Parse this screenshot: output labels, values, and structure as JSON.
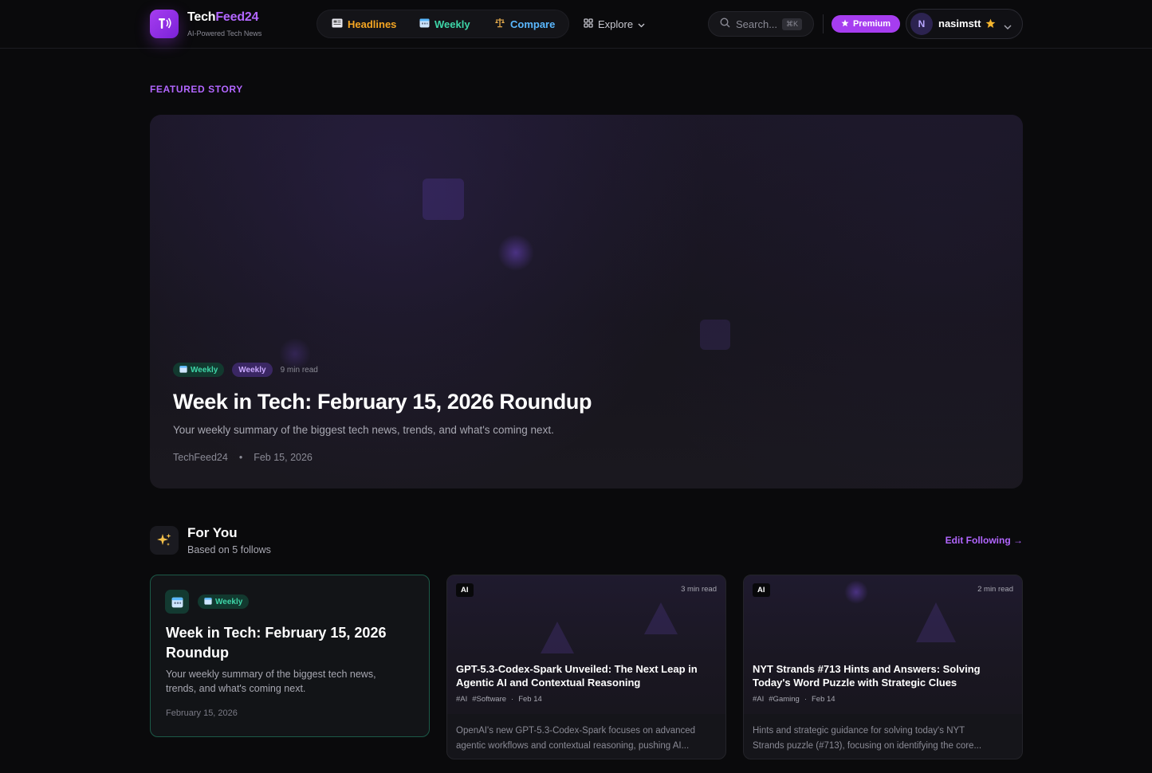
{
  "brand": {
    "name_part1": "Tech",
    "name_part2": "Feed24",
    "tagline": "AI-Powered Tech News"
  },
  "nav": {
    "headlines": "Headlines",
    "weekly": "Weekly",
    "compare": "Compare",
    "explore": "Explore"
  },
  "search": {
    "placeholder": "Search...",
    "shortcut": "⌘K"
  },
  "premium_label": "Premium",
  "user": {
    "initial": "N",
    "name": "nasimstt"
  },
  "featured": {
    "section_label": "FEATURED STORY",
    "badge_weekly_green": "Weekly",
    "badge_weekly_purple": "Weekly",
    "read_time": "9 min read",
    "title": "Week in Tech: February 15, 2026 Roundup",
    "description": "Your weekly summary of the biggest tech news, trends, and what's coming next.",
    "source": "TechFeed24",
    "separator": "•",
    "date": "Feb 15, 2026"
  },
  "for_you": {
    "title": "For You",
    "subtitle": "Based on 5 follows",
    "edit_link": "Edit Following →",
    "cards": [
      {
        "badge": "Weekly",
        "title": "Week in Tech: February 15, 2026 Roundup",
        "description": "Your weekly summary of the biggest tech news, trends, and what's coming next.",
        "date": "February 15, 2026"
      },
      {
        "tag": "AI",
        "read_time": "3 min read",
        "title": "GPT-5.3-Codex-Spark Unveiled: The Next Leap in Agentic AI and Contextual Reasoning",
        "tags": [
          "#AI",
          "#Software"
        ],
        "date": "Feb 14",
        "description_line1": "OpenAI's new GPT-5.3-Codex-Spark focuses on advanced",
        "description_line2": "agentic workflows and contextual reasoning, pushing AI..."
      },
      {
        "tag": "AI",
        "read_time": "2 min read",
        "title": "NYT Strands #713 Hints and Answers: Solving Today's Word Puzzle with Strategic Clues",
        "tags": [
          "#AI",
          "#Gaming"
        ],
        "date": "Feb 14",
        "description_line1": "Hints and strategic guidance for solving today's NYT",
        "description_line2": "Strands puzzle (#713), focusing on identifying the core..."
      }
    ]
  },
  "colors": {
    "background": "#0a0a0c",
    "brand_purple": "#a63df0",
    "headlines_orange": "#f5a623",
    "weekly_green": "#3ed6a8",
    "compare_blue": "#5ab8ff"
  },
  "icons": {
    "logo": "tech-feed-logo-icon",
    "headlines": "newspaper-icon",
    "weekly": "calendar-icon",
    "compare": "scales-icon",
    "explore": "grid-icon",
    "search": "search-icon",
    "premium": "star-icon",
    "user_star": "star-icon",
    "user_menu": "chevron-down-icon",
    "for_you": "sparkles-icon"
  }
}
